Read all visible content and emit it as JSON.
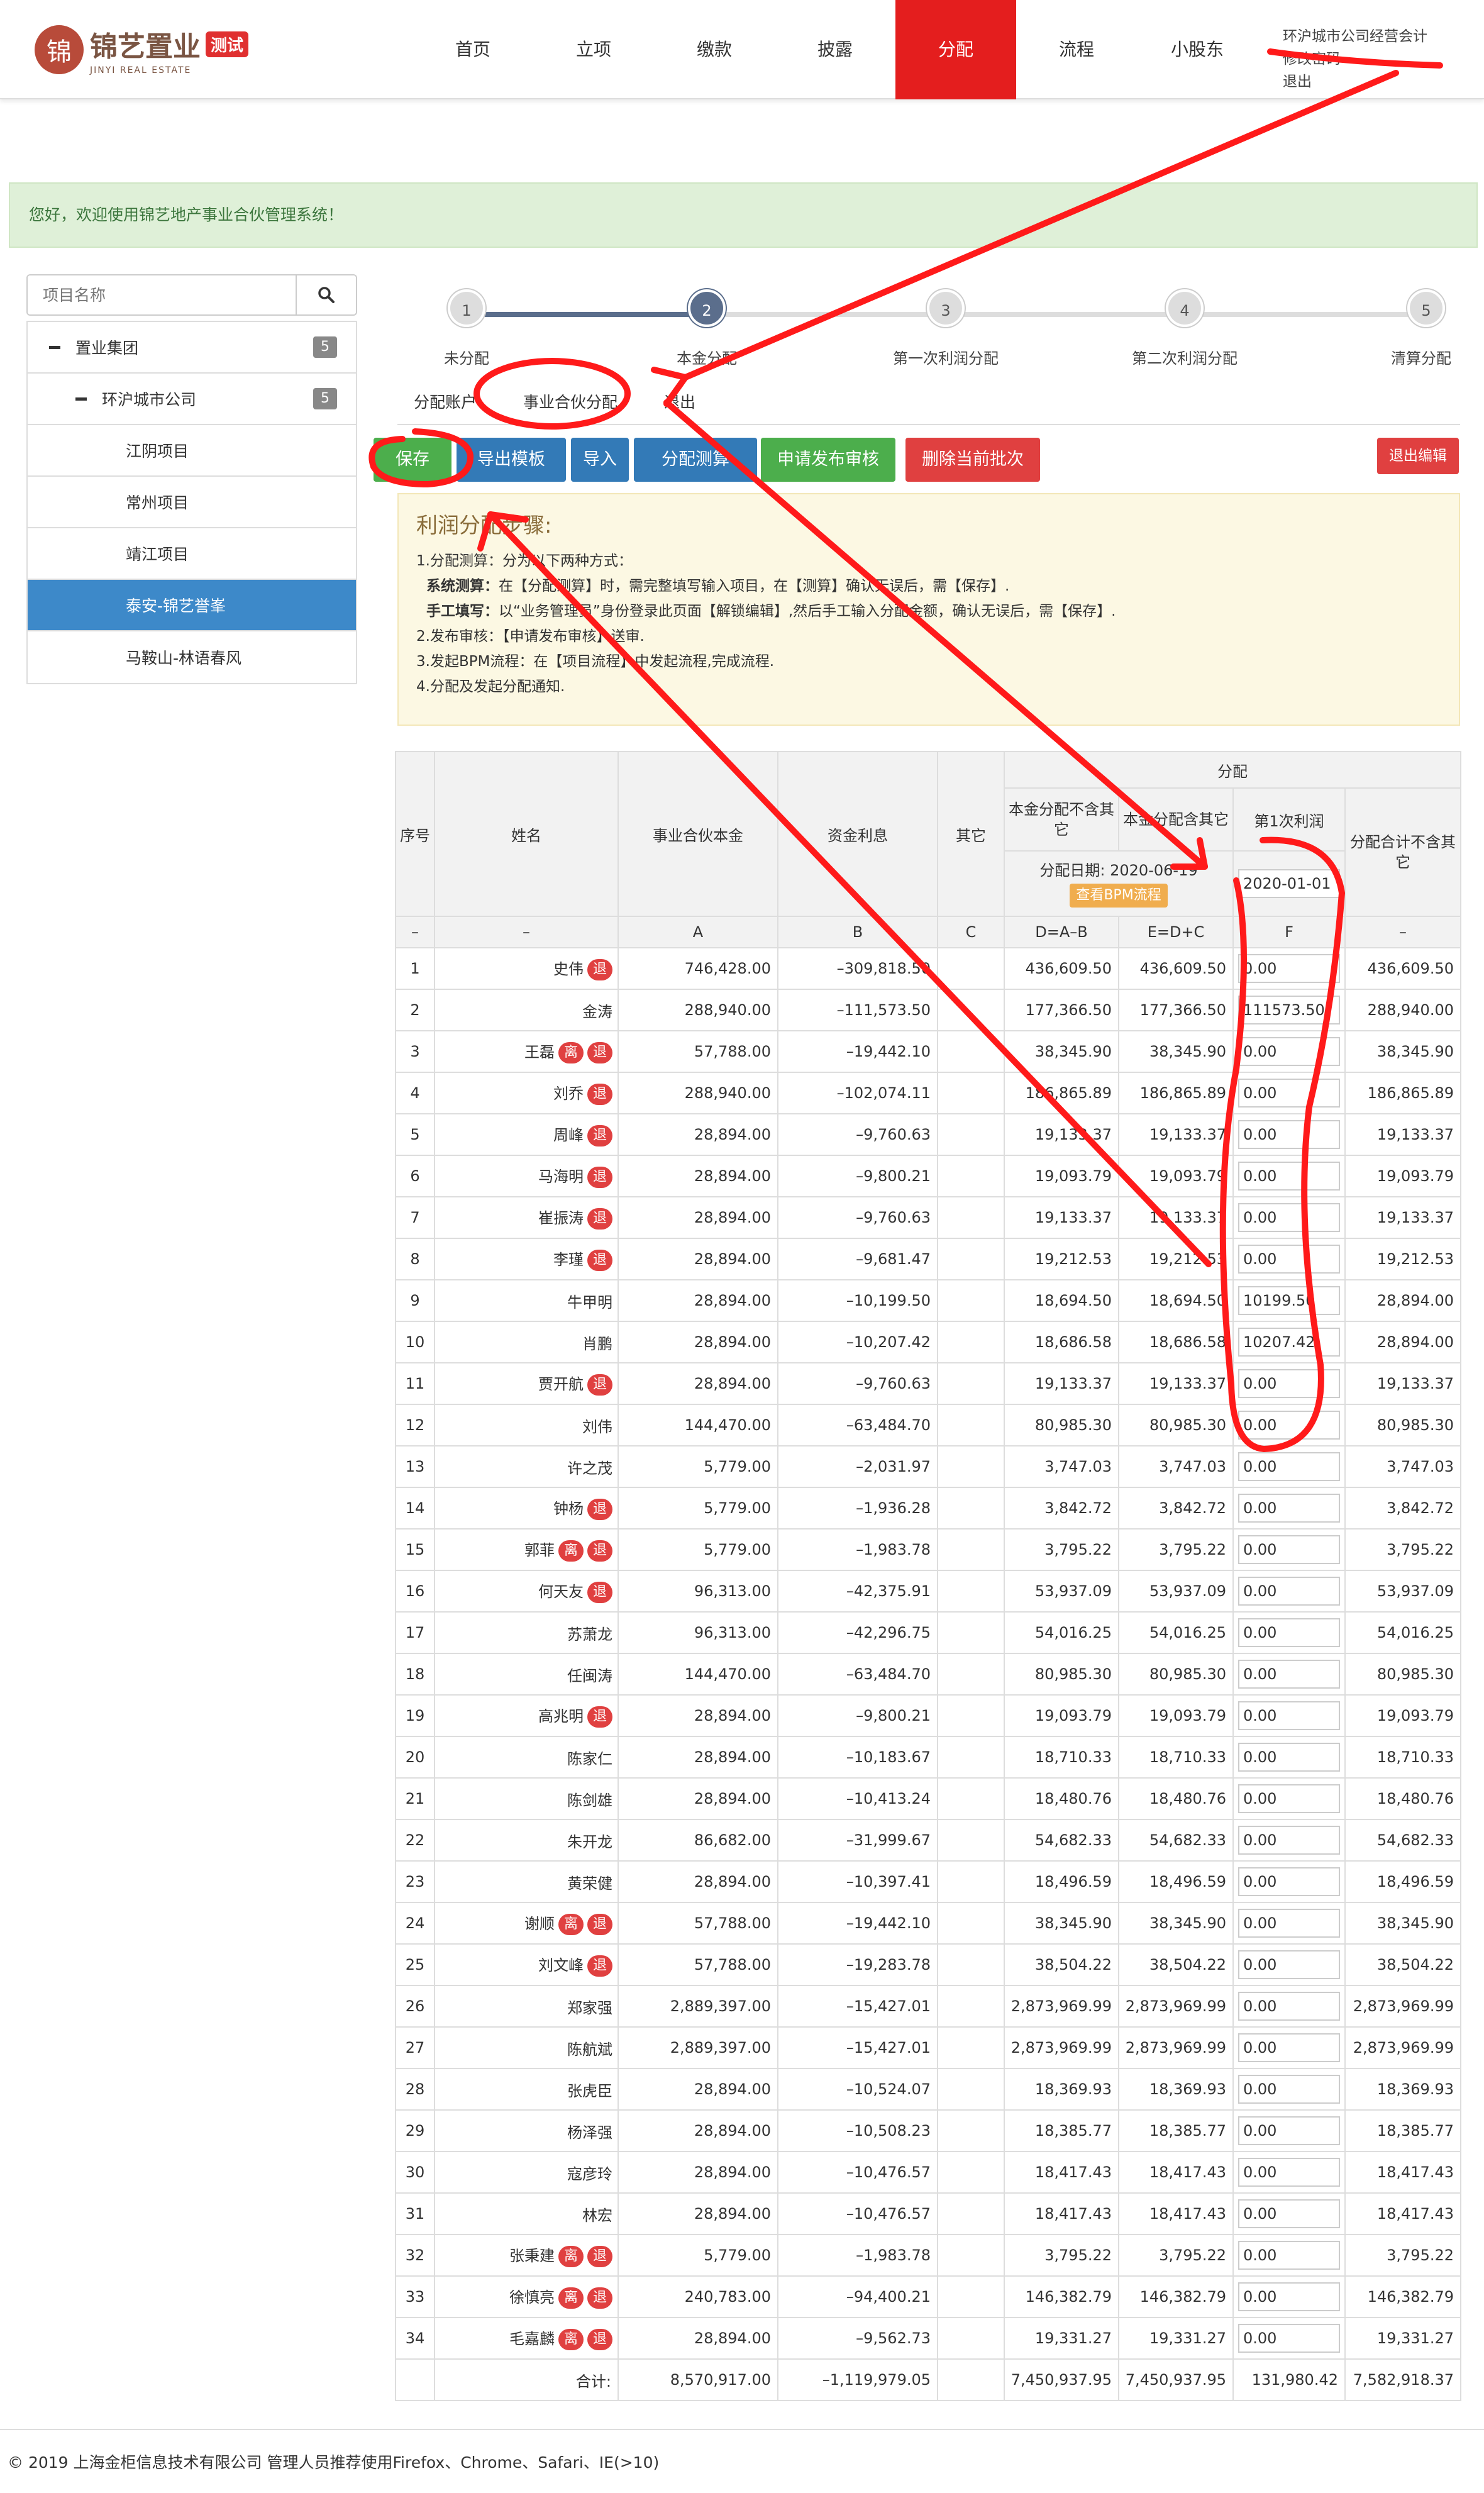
{
  "header": {
    "logo_cn": "锦艺置业",
    "logo_tag": "测试",
    "logo_en": "JINYI REAL ESTATE",
    "nav": [
      "首页",
      "立项",
      "缴款",
      "披露",
      "分配",
      "流程",
      "小股东"
    ],
    "active_nav": "分配",
    "user_lines": [
      "环沪城市公司经营会计",
      "修改密码",
      "退出"
    ]
  },
  "welcome": "您好，欢迎使用锦艺地产事业合伙管理系统！",
  "sidebar": {
    "search_placeholder": "项目名称",
    "items": [
      {
        "label": "置业集团",
        "count": "5"
      },
      {
        "label": "环沪城市公司",
        "count": "5"
      },
      {
        "label": "江阴项目"
      },
      {
        "label": "常州项目"
      },
      {
        "label": "靖江项目"
      },
      {
        "label": "泰安-锦艺誉峯",
        "active": true
      },
      {
        "label": "马鞍山-林语春风"
      }
    ]
  },
  "steps": [
    {
      "num": "1",
      "label": "未分配"
    },
    {
      "num": "2",
      "label": "本金分配"
    },
    {
      "num": "3",
      "label": "第一次利润分配"
    },
    {
      "num": "4",
      "label": "第二次利润分配"
    },
    {
      "num": "5",
      "label": "清算分配"
    }
  ],
  "tabs": [
    "分配账户",
    "事业合伙分配",
    "退出"
  ],
  "toolbar": {
    "save": "保存",
    "export": "导出模板",
    "import": "导入",
    "calc": "分配测算",
    "submit": "申请发布审核",
    "delete": "删除当前批次",
    "exit_edit": "退出编辑"
  },
  "notice": {
    "title": "利润分配步骤:",
    "line1": "1.分配测算：分为以下两种方式：",
    "line2a": "系统测算：",
    "line2b": "在【分配测算】时，需完整填写输入项目，在【测算】确认无误后，需【保存】.",
    "line3a": "手工填写：",
    "line3b": "以“业务管理员”身份登录此页面【解锁编辑】,然后手工输入分配金额，确认无误后，需【保存】.",
    "line4": "2.发布审核：【申请发布审核】送审.",
    "line5": "3.发起BPM流程：在【项目流程】中发起流程,完成流程.",
    "line6": "4.分配及发起分配通知."
  },
  "table": {
    "headers": {
      "seq": "序号",
      "name": "姓名",
      "capital": "事业合伙本金",
      "interest": "资金利息",
      "other": "其它",
      "dist": "分配",
      "d_excl": "本金分配不含其它",
      "d_incl": "本金分配含其它",
      "first_profit": "第1次利润",
      "total": "分配合计不含其它",
      "dist_date_label": "分配日期:",
      "dist_date": "2020-06-19",
      "bpm": "查看BPM流程",
      "profit_date": "2020-01-01"
    },
    "formula_row": [
      "–",
      "–",
      "A",
      "B",
      "C",
      "D=A–B",
      "E=D+C",
      "F",
      "–"
    ],
    "rows": [
      [
        "1",
        "史伟",
        [
          "退"
        ],
        "746,428.00",
        "–309,818.50",
        "",
        "436,609.50",
        "436,609.50",
        "0.00",
        "436,609.50"
      ],
      [
        "2",
        "金涛",
        [],
        "288,940.00",
        "–111,573.50",
        "",
        "177,366.50",
        "177,366.50",
        "111573.50",
        "288,940.00"
      ],
      [
        "3",
        "王磊",
        [
          "离",
          "退"
        ],
        "57,788.00",
        "–19,442.10",
        "",
        "38,345.90",
        "38,345.90",
        "0.00",
        "38,345.90"
      ],
      [
        "4",
        "刘乔",
        [
          "退"
        ],
        "288,940.00",
        "–102,074.11",
        "",
        "186,865.89",
        "186,865.89",
        "0.00",
        "186,865.89"
      ],
      [
        "5",
        "周峰",
        [
          "退"
        ],
        "28,894.00",
        "–9,760.63",
        "",
        "19,133.37",
        "19,133.37",
        "0.00",
        "19,133.37"
      ],
      [
        "6",
        "马海明",
        [
          "退"
        ],
        "28,894.00",
        "–9,800.21",
        "",
        "19,093.79",
        "19,093.79",
        "0.00",
        "19,093.79"
      ],
      [
        "7",
        "崔振涛",
        [
          "退"
        ],
        "28,894.00",
        "–9,760.63",
        "",
        "19,133.37",
        "19,133.37",
        "0.00",
        "19,133.37"
      ],
      [
        "8",
        "李瑾",
        [
          "退"
        ],
        "28,894.00",
        "–9,681.47",
        "",
        "19,212.53",
        "19,212.53",
        "0.00",
        "19,212.53"
      ],
      [
        "9",
        "牛甲明",
        [],
        "28,894.00",
        "–10,199.50",
        "",
        "18,694.50",
        "18,694.50",
        "10199.50",
        "28,894.00"
      ],
      [
        "10",
        "肖鹏",
        [],
        "28,894.00",
        "–10,207.42",
        "",
        "18,686.58",
        "18,686.58",
        "10207.42",
        "28,894.00"
      ],
      [
        "11",
        "贾开航",
        [
          "退"
        ],
        "28,894.00",
        "–9,760.63",
        "",
        "19,133.37",
        "19,133.37",
        "0.00",
        "19,133.37"
      ],
      [
        "12",
        "刘伟",
        [],
        "144,470.00",
        "–63,484.70",
        "",
        "80,985.30",
        "80,985.30",
        "0.00",
        "80,985.30"
      ],
      [
        "13",
        "许之茂",
        [],
        "5,779.00",
        "–2,031.97",
        "",
        "3,747.03",
        "3,747.03",
        "0.00",
        "3,747.03"
      ],
      [
        "14",
        "钟杨",
        [
          "退"
        ],
        "5,779.00",
        "–1,936.28",
        "",
        "3,842.72",
        "3,842.72",
        "0.00",
        "3,842.72"
      ],
      [
        "15",
        "郭菲",
        [
          "离",
          "退"
        ],
        "5,779.00",
        "–1,983.78",
        "",
        "3,795.22",
        "3,795.22",
        "0.00",
        "3,795.22"
      ],
      [
        "16",
        "何天友",
        [
          "退"
        ],
        "96,313.00",
        "–42,375.91",
        "",
        "53,937.09",
        "53,937.09",
        "0.00",
        "53,937.09"
      ],
      [
        "17",
        "苏萧龙",
        [],
        "96,313.00",
        "–42,296.75",
        "",
        "54,016.25",
        "54,016.25",
        "0.00",
        "54,016.25"
      ],
      [
        "18",
        "任闽涛",
        [],
        "144,470.00",
        "–63,484.70",
        "",
        "80,985.30",
        "80,985.30",
        "0.00",
        "80,985.30"
      ],
      [
        "19",
        "高兆明",
        [
          "退"
        ],
        "28,894.00",
        "–9,800.21",
        "",
        "19,093.79",
        "19,093.79",
        "0.00",
        "19,093.79"
      ],
      [
        "20",
        "陈家仁",
        [],
        "28,894.00",
        "–10,183.67",
        "",
        "18,710.33",
        "18,710.33",
        "0.00",
        "18,710.33"
      ],
      [
        "21",
        "陈剑雄",
        [],
        "28,894.00",
        "–10,413.24",
        "",
        "18,480.76",
        "18,480.76",
        "0.00",
        "18,480.76"
      ],
      [
        "22",
        "朱开龙",
        [],
        "86,682.00",
        "–31,999.67",
        "",
        "54,682.33",
        "54,682.33",
        "0.00",
        "54,682.33"
      ],
      [
        "23",
        "黄荣健",
        [],
        "28,894.00",
        "–10,397.41",
        "",
        "18,496.59",
        "18,496.59",
        "0.00",
        "18,496.59"
      ],
      [
        "24",
        "谢顺",
        [
          "离",
          "退"
        ],
        "57,788.00",
        "–19,442.10",
        "",
        "38,345.90",
        "38,345.90",
        "0.00",
        "38,345.90"
      ],
      [
        "25",
        "刘文峰",
        [
          "退"
        ],
        "57,788.00",
        "–19,283.78",
        "",
        "38,504.22",
        "38,504.22",
        "0.00",
        "38,504.22"
      ],
      [
        "26",
        "郑家强",
        [],
        "2,889,397.00",
        "–15,427.01",
        "",
        "2,873,969.99",
        "2,873,969.99",
        "0.00",
        "2,873,969.99"
      ],
      [
        "27",
        "陈航斌",
        [],
        "2,889,397.00",
        "–15,427.01",
        "",
        "2,873,969.99",
        "2,873,969.99",
        "0.00",
        "2,873,969.99"
      ],
      [
        "28",
        "张虎臣",
        [],
        "28,894.00",
        "–10,524.07",
        "",
        "18,369.93",
        "18,369.93",
        "0.00",
        "18,369.93"
      ],
      [
        "29",
        "杨泽强",
        [],
        "28,894.00",
        "–10,508.23",
        "",
        "18,385.77",
        "18,385.77",
        "0.00",
        "18,385.77"
      ],
      [
        "30",
        "寇彦玲",
        [],
        "28,894.00",
        "–10,476.57",
        "",
        "18,417.43",
        "18,417.43",
        "0.00",
        "18,417.43"
      ],
      [
        "31",
        "林宏",
        [],
        "28,894.00",
        "–10,476.57",
        "",
        "18,417.43",
        "18,417.43",
        "0.00",
        "18,417.43"
      ],
      [
        "32",
        "张秉建",
        [
          "离",
          "退"
        ],
        "5,779.00",
        "–1,983.78",
        "",
        "3,795.22",
        "3,795.22",
        "0.00",
        "3,795.22"
      ],
      [
        "33",
        "徐慎亮",
        [
          "离",
          "退"
        ],
        "240,783.00",
        "–94,400.21",
        "",
        "146,382.79",
        "146,382.79",
        "0.00",
        "146,382.79"
      ],
      [
        "34",
        "毛嘉麟",
        [
          "离",
          "退"
        ],
        "28,894.00",
        "–9,562.73",
        "",
        "19,331.27",
        "19,331.27",
        "0.00",
        "19,331.27"
      ]
    ],
    "total_row": {
      "label": "合计:",
      "capital": "8,570,917.00",
      "interest": "–1,119,979.05",
      "other": "",
      "d": "7,450,937.95",
      "e": "7,450,937.95",
      "f": "131,980.42",
      "total": "7,582,918.37"
    }
  },
  "footer": "© 2019 上海金柜信息技术有限公司  管理人员推荐使用Firefox、Chrome、Safari、IE(>10)",
  "colors": {
    "active_nav": "#e41e1e",
    "annotation": "#ff1a1a",
    "sidebar_active": "#3d89c9"
  }
}
